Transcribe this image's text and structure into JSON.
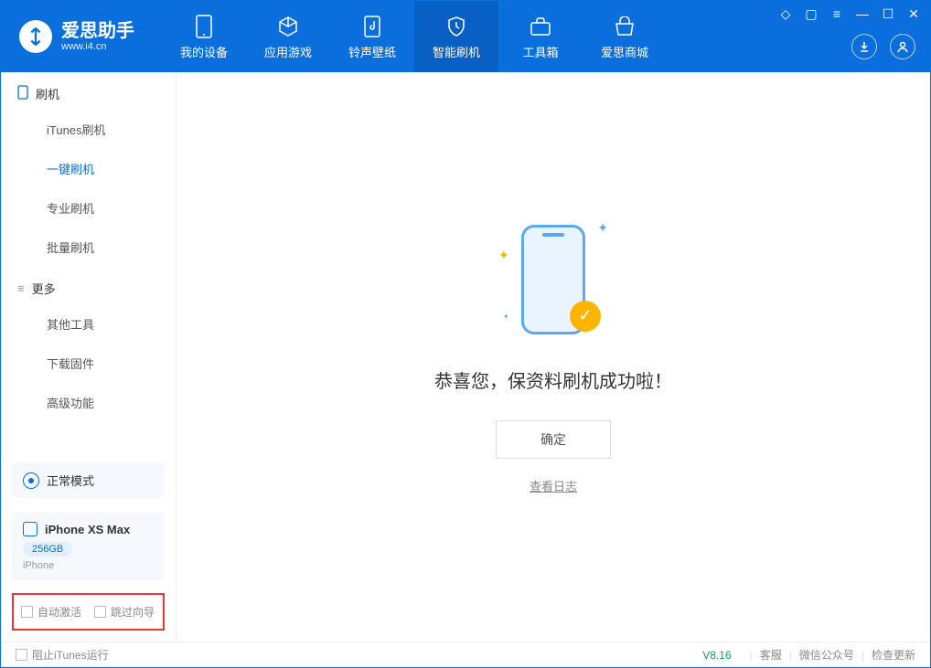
{
  "app": {
    "name": "爱思助手",
    "url": "www.i4.cn"
  },
  "nav": {
    "tabs": [
      {
        "label": "我的设备"
      },
      {
        "label": "应用游戏"
      },
      {
        "label": "铃声壁纸"
      },
      {
        "label": "智能刷机"
      },
      {
        "label": "工具箱"
      },
      {
        "label": "爱思商城"
      }
    ]
  },
  "sidebar": {
    "section1": {
      "title": "刷机",
      "items": [
        "iTunes刷机",
        "一键刷机",
        "专业刷机",
        "批量刷机"
      ]
    },
    "section2": {
      "title": "更多",
      "items": [
        "其他工具",
        "下载固件",
        "高级功能"
      ]
    },
    "mode": "正常模式",
    "device": {
      "name": "iPhone XS Max",
      "storage": "256GB",
      "type": "iPhone"
    },
    "checks": {
      "auto_activate": "自动激活",
      "skip_guide": "跳过向导"
    }
  },
  "main": {
    "success": "恭喜您，保资料刷机成功啦！",
    "ok": "确定",
    "view_log": "查看日志"
  },
  "footer": {
    "block_itunes": "阻止iTunes运行",
    "version": "V8.16",
    "links": [
      "客服",
      "微信公众号",
      "检查更新"
    ]
  }
}
